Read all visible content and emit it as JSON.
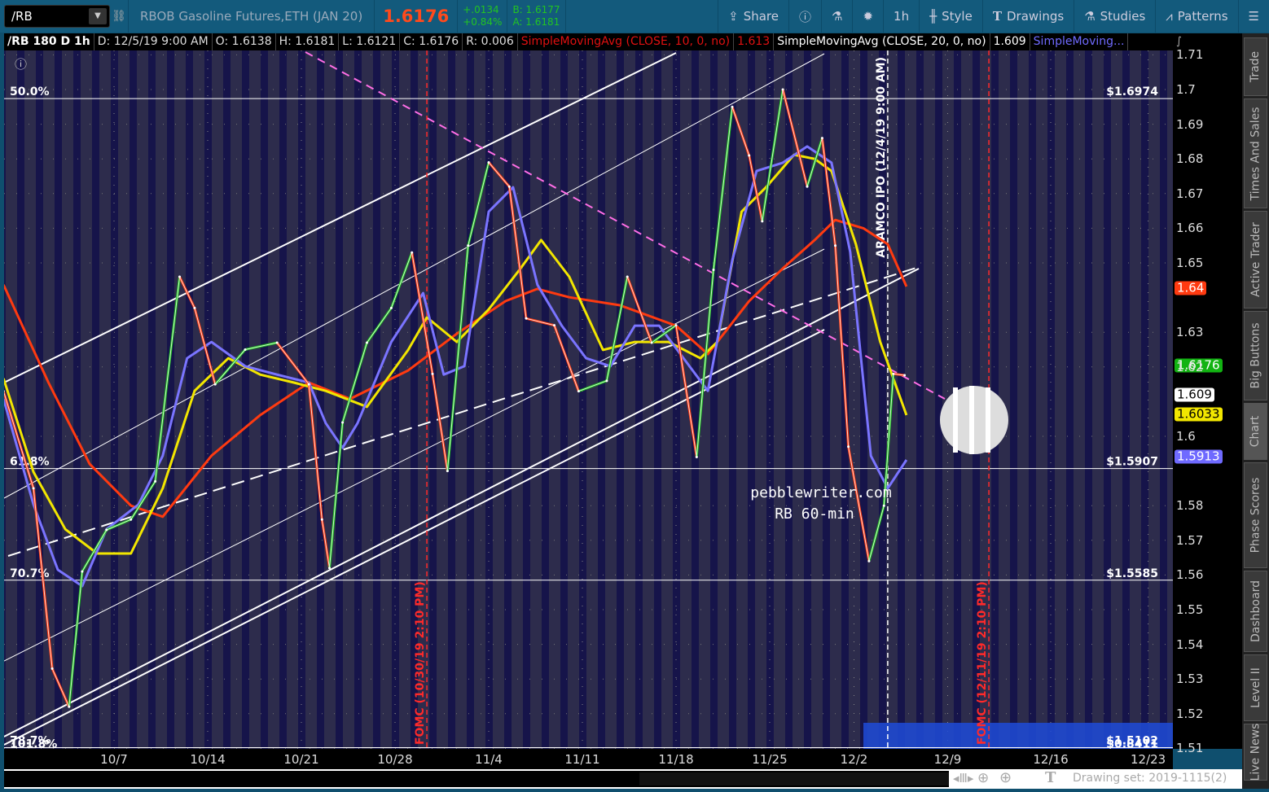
{
  "toolbar": {
    "symbol": "/RB",
    "description": "RBOB Gasoline Futures,ETH (JAN 20)",
    "last": "1.6176",
    "change": "+.0134",
    "change_pct": "+0.84%",
    "bid": "B: 1.6177",
    "ask": "A: 1.6181",
    "share": "Share",
    "timeframe": "1h",
    "style": "Style",
    "drawings": "Drawings",
    "studies": "Studies",
    "patterns": "Patterns"
  },
  "infobar": {
    "title": "/RB 180 D 1h",
    "date": "D: 12/5/19 9:00 AM",
    "open": "O: 1.6138",
    "high": "H: 1.6181",
    "low": "L: 1.6121",
    "close": "C: 1.6176",
    "range": "R: 0.006",
    "sma1": "SimpleMovingAvg (CLOSE, 10, 0, no)",
    "sma1_val": "1.613",
    "sma2": "SimpleMovingAvg (CLOSE, 20, 0, no)",
    "sma2_val": "1.609",
    "sma3": "SimpleMoving..."
  },
  "sidebar": [
    "Trade",
    "Times And Sales",
    "Active Trader",
    "Big Buttons",
    "Chart",
    "Phase Scores",
    "Dashboard",
    "Level II",
    "Live News"
  ],
  "bottom": {
    "drawing_set": "Drawing set: 2019-1115(2)"
  },
  "colors": {
    "bg": "#2d2c4c",
    "stripe": "#16144a",
    "price_up": "#1fbf1f",
    "price_down": "#ff3a10",
    "sma_red": "#ff3a10",
    "sma_yellow": "#f2e600",
    "sma_blue": "#7a74ff",
    "magenta": "#ff6ee6"
  },
  "chart_data": {
    "type": "line",
    "title": "RB 60-min",
    "watermark": "pebblewriter.com",
    "x_unit": "trading days from 10/7",
    "x_ticks": [
      {
        "t": 0,
        "label": "10/7"
      },
      {
        "t": 5,
        "label": "10/14"
      },
      {
        "t": 10,
        "label": "10/21"
      },
      {
        "t": 15,
        "label": "10/28"
      },
      {
        "t": 20,
        "label": "11/4"
      },
      {
        "t": 25,
        "label": "11/11"
      },
      {
        "t": 30,
        "label": "11/18"
      },
      {
        "t": 35,
        "label": "11/25"
      },
      {
        "t": 39.5,
        "label": "12/2"
      },
      {
        "t": 44.5,
        "label": "12/9"
      },
      {
        "t": 50,
        "label": "12/16"
      },
      {
        "t": 55.2,
        "label": "12/23"
      }
    ],
    "y_ticks": [
      "1.71",
      "1.7",
      "1.69",
      "1.68",
      "1.67",
      "1.66",
      "1.65",
      "1.63",
      "1.62",
      "1.6",
      "1.58",
      "1.57",
      "1.56",
      "1.55",
      "1.54",
      "1.53",
      "1.52",
      "1.51"
    ],
    "ylim": [
      1.5045,
      1.7103
    ],
    "price": [
      [
        -5.9,
        1.613
      ],
      [
        -4.3,
        1.585
      ],
      [
        -3.3,
        1.533
      ],
      [
        -2.4,
        1.522
      ],
      [
        -1.7,
        1.561
      ],
      [
        -0.4,
        1.573
      ],
      [
        0.9,
        1.576
      ],
      [
        2.2,
        1.587
      ],
      [
        3.5,
        1.646
      ],
      [
        4.3,
        1.637
      ],
      [
        5.4,
        1.615
      ],
      [
        7,
        1.625
      ],
      [
        8.7,
        1.627
      ],
      [
        10.4,
        1.615
      ],
      [
        11.1,
        1.576
      ],
      [
        11.5,
        1.562
      ],
      [
        12.2,
        1.604
      ],
      [
        13.5,
        1.627
      ],
      [
        14.8,
        1.637
      ],
      [
        15.9,
        1.653
      ],
      [
        17,
        1.618
      ],
      [
        17.8,
        1.59
      ],
      [
        18.9,
        1.655
      ],
      [
        20,
        1.679
      ],
      [
        21.1,
        1.672
      ],
      [
        22,
        1.634
      ],
      [
        23.5,
        1.632
      ],
      [
        24.8,
        1.613
      ],
      [
        26.3,
        1.616
      ],
      [
        27.4,
        1.646
      ],
      [
        28.7,
        1.627
      ],
      [
        30,
        1.632
      ],
      [
        31.1,
        1.594
      ],
      [
        32,
        1.648
      ],
      [
        33,
        1.695
      ],
      [
        33.9,
        1.681
      ],
      [
        34.6,
        1.662
      ],
      [
        35.7,
        1.7
      ],
      [
        37,
        1.672
      ],
      [
        37.8,
        1.686
      ],
      [
        38.5,
        1.655
      ],
      [
        39.2,
        1.597
      ],
      [
        40.3,
        1.564
      ],
      [
        41.1,
        1.58
      ],
      [
        41.6,
        1.618
      ],
      [
        42.2,
        1.6176
      ]
    ],
    "series": [
      {
        "name": "SMA red",
        "color": "#ff3a10",
        "last": "1.64",
        "points": [
          [
            -5.9,
            1.6437
          ],
          [
            -3.5,
            1.6155
          ],
          [
            -1.3,
            1.592
          ],
          [
            0.9,
            1.58
          ],
          [
            2.6,
            1.5768
          ],
          [
            5.2,
            1.5944
          ],
          [
            7.8,
            1.6061
          ],
          [
            10.4,
            1.6155
          ],
          [
            12.6,
            1.6108
          ],
          [
            15.7,
            1.619
          ],
          [
            18.3,
            1.6296
          ],
          [
            20.9,
            1.639
          ],
          [
            22.6,
            1.6425
          ],
          [
            24.3,
            1.6401
          ],
          [
            27,
            1.6378
          ],
          [
            30,
            1.6319
          ],
          [
            31.7,
            1.6237
          ],
          [
            33.9,
            1.639
          ],
          [
            35.7,
            1.6484
          ],
          [
            37.4,
            1.6566
          ],
          [
            38.5,
            1.6624
          ],
          [
            40,
            1.66
          ],
          [
            41.3,
            1.6554
          ],
          [
            42.3,
            1.6432
          ]
        ]
      },
      {
        "name": "SMA yellow",
        "color": "#f2e600",
        "last": "1.6033",
        "points": [
          [
            -5.9,
            1.6167
          ],
          [
            -4.3,
            1.5897
          ],
          [
            -2.6,
            1.5732
          ],
          [
            -0.9,
            1.5662
          ],
          [
            0.9,
            1.5662
          ],
          [
            2.6,
            1.585
          ],
          [
            4.3,
            1.6131
          ],
          [
            6.1,
            1.6225
          ],
          [
            7.8,
            1.6178
          ],
          [
            9.6,
            1.6155
          ],
          [
            11.3,
            1.6131
          ],
          [
            13.5,
            1.6085
          ],
          [
            15.7,
            1.6249
          ],
          [
            16.7,
            1.6343
          ],
          [
            18.3,
            1.6272
          ],
          [
            20,
            1.6366
          ],
          [
            21.7,
            1.6484
          ],
          [
            22.8,
            1.6566
          ],
          [
            24.3,
            1.646
          ],
          [
            26.1,
            1.6249
          ],
          [
            27.8,
            1.6272
          ],
          [
            29.6,
            1.6272
          ],
          [
            31.3,
            1.6225
          ],
          [
            32.2,
            1.6272
          ],
          [
            33.5,
            1.6648
          ],
          [
            34.8,
            1.6718
          ],
          [
            36.3,
            1.6812
          ],
          [
            37.4,
            1.68
          ],
          [
            38.3,
            1.6765
          ],
          [
            39.6,
            1.6554
          ],
          [
            40.9,
            1.6272
          ],
          [
            42.3,
            1.6061
          ]
        ]
      },
      {
        "name": "SMA blue",
        "color": "#7a74ff",
        "last": "1.5913",
        "points": [
          [
            -5.9,
            1.6108
          ],
          [
            -4.3,
            1.5803
          ],
          [
            -3,
            1.5615
          ],
          [
            -1.7,
            1.5568
          ],
          [
            -0.4,
            1.5732
          ],
          [
            1.3,
            1.5803
          ],
          [
            2.6,
            1.5944
          ],
          [
            3.9,
            1.6225
          ],
          [
            5.2,
            1.6272
          ],
          [
            7,
            1.6202
          ],
          [
            8.7,
            1.6178
          ],
          [
            10.4,
            1.6155
          ],
          [
            11.3,
            1.6038
          ],
          [
            12.2,
            1.5967
          ],
          [
            13,
            1.6038
          ],
          [
            14.8,
            1.6272
          ],
          [
            16.5,
            1.6413
          ],
          [
            17.6,
            1.6178
          ],
          [
            18.7,
            1.6202
          ],
          [
            20,
            1.6648
          ],
          [
            21.3,
            1.6718
          ],
          [
            22.6,
            1.6437
          ],
          [
            23.9,
            1.6319
          ],
          [
            25.2,
            1.6225
          ],
          [
            26.5,
            1.6202
          ],
          [
            27.8,
            1.6319
          ],
          [
            29.1,
            1.6319
          ],
          [
            30.4,
            1.6225
          ],
          [
            31.7,
            1.6131
          ],
          [
            33,
            1.6507
          ],
          [
            34.3,
            1.6765
          ],
          [
            35.7,
            1.6789
          ],
          [
            37,
            1.6836
          ],
          [
            38.3,
            1.6789
          ],
          [
            39.3,
            1.6531
          ],
          [
            40.4,
            1.5944
          ],
          [
            41.3,
            1.585
          ],
          [
            42.3,
            1.5932
          ]
        ]
      }
    ],
    "sma_white_last": "1.609",
    "last_price": "1.6176",
    "fib_levels": [
      {
        "price": 1.6974,
        "left": "50.0%",
        "right": "$1.6974"
      },
      {
        "price": 1.5907,
        "left": "61.8%",
        "right": "$1.5907"
      },
      {
        "price": 1.5585,
        "left": "70.7%",
        "right": "$1.5585"
      },
      {
        "price": 1.5102,
        "left": "78.7%",
        "right": "$1.5102"
      },
      {
        "price": 1.5102,
        "left": "101.8%",
        "right": "$0.8411"
      }
    ],
    "events": [
      {
        "t": 16.7,
        "label": "FOMC (10/30/19 2:10 PM)",
        "color": "#ff2a2a"
      },
      {
        "t": 41.3,
        "label": "ARAMCO IPO (12/4/19 9:00 AM)",
        "color": "#ffffff"
      },
      {
        "t": 46.7,
        "label": "FOMC (12/11/19 2:10 PM)",
        "color": "#ff2a2a"
      }
    ]
  }
}
